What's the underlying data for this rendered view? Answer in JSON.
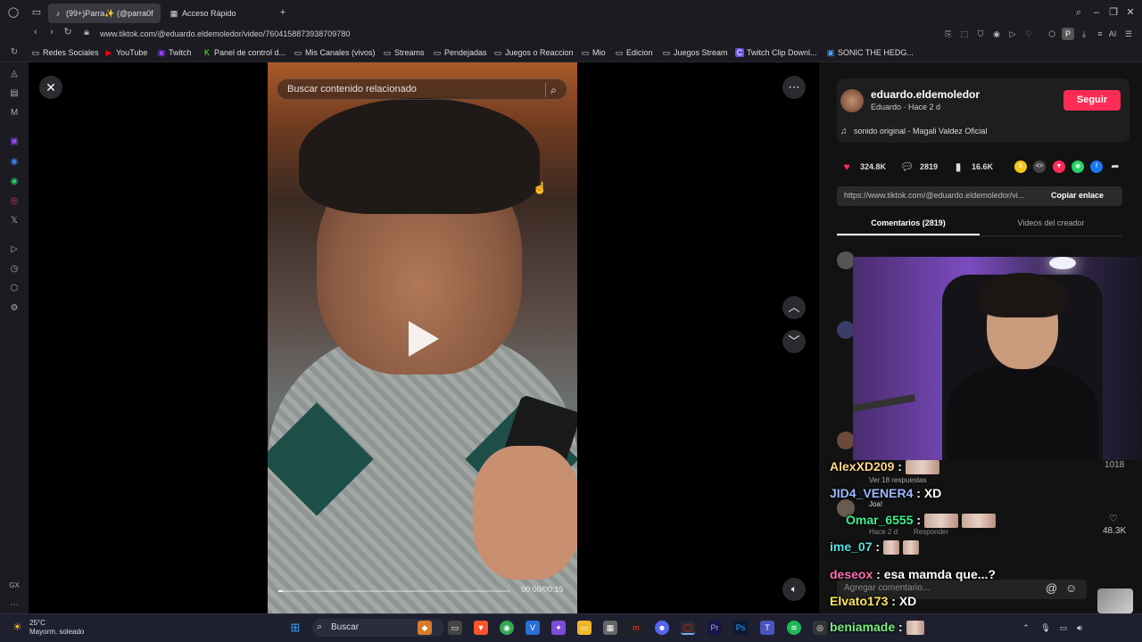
{
  "browser": {
    "tabs": [
      {
        "label": "(99+)Parra✨ (@parra0f",
        "active": true
      },
      {
        "label": "Acceso Rápido",
        "active": false
      }
    ],
    "url": "www.tiktok.com/@eduardo.eldemoledor/video/7604158873938709780",
    "bookmarks": [
      "Redes Sociales",
      "YouTube",
      "Twitch",
      "Panel de control d...",
      "Mis Canales (vivos)",
      "Streams",
      "Pendejadas",
      "Juegos o Reaccion",
      "Mio",
      "Edicion",
      "Juegos Stream",
      "Twitch Clip Downl...",
      "SONIC THE HEDG..."
    ],
    "new_tab": "+",
    "ai_label": "AI",
    "profile_initial": "P"
  },
  "video": {
    "search_placeholder": "Buscar contenido relacionado",
    "time": "00:00/00:15",
    "progress_fraction": 0.02
  },
  "author": {
    "username": "eduardo.eldemoledor",
    "subtitle": "Eduardo · Hace 2 d",
    "follow_label": "Seguir",
    "music": "sonido original - Magali Valdez Oficial"
  },
  "stats": {
    "likes": "324.8K",
    "comments": "2819",
    "saves": "16.6K"
  },
  "link": {
    "url": "https://www.tiktok.com/@eduardo.eldemoledor/vi...",
    "copy_label": "Copiar enlace"
  },
  "panel_tabs": [
    "Comentarios (2819)",
    "Videos del creador"
  ],
  "comments": {
    "top_count": "1018",
    "replies_label": "Ver 18 respuestas",
    "second_name": "Joa!",
    "second_meta": "Hace 2 d",
    "second_reply": "Responder",
    "second_likes": "48.3K",
    "add_placeholder": "Agregar comentario..."
  },
  "chat": [
    {
      "name": "AlexXD209",
      "text": "",
      "color": "#ffd58a"
    },
    {
      "name": "JID4_VENER4",
      "text": "XD",
      "color": "#9ab8ff"
    },
    {
      "name": "Omar_6555",
      "text": "",
      "color": "#3cf08a"
    },
    {
      "name": "ime_07",
      "text": "",
      "color": "#56e0e0"
    },
    {
      "name": "deseox",
      "text": "esa mamda que...?",
      "color": "#ff6fb0"
    },
    {
      "name": "Elvato173",
      "text": "XD",
      "color": "#ffe45a"
    },
    {
      "name": "beniamade",
      "text": "",
      "color": "#7cf07c"
    }
  ],
  "taskbar": {
    "temp": "25°C",
    "weather": "Mayorm. soleado",
    "search": "Buscar"
  },
  "sidebar_gx": "GX",
  "colors": {
    "accent": "#fe2c55",
    "like": "#fe2c55",
    "background": "#000000"
  }
}
